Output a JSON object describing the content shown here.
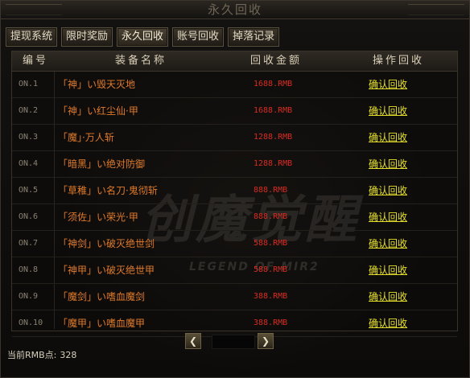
{
  "window": {
    "title": "永久回收"
  },
  "tabs": [
    {
      "label": "提现系统"
    },
    {
      "label": "限时奖励"
    },
    {
      "label": "永久回收"
    },
    {
      "label": "账号回收"
    },
    {
      "label": "掉落记录"
    }
  ],
  "table": {
    "headers": {
      "no": "编号",
      "name": "装备名称",
      "price": "回收金额",
      "action": "操作回收"
    },
    "rows": [
      {
        "no": "ON.1",
        "name": "「神」い毁天灭地",
        "price": "1688.RMB",
        "action": "确认回收"
      },
      {
        "no": "ON.2",
        "name": "「神」い红尘仙·甲",
        "price": "1688.RMB",
        "action": "确认回收"
      },
      {
        "no": "ON.3",
        "name": "「魔」·万人斩",
        "price": "1288.RMB",
        "action": "确认回收"
      },
      {
        "no": "ON.4",
        "name": "「暗黑」い绝对防御",
        "price": "1288.RMB",
        "action": "确认回收"
      },
      {
        "no": "ON.5",
        "name": "「草稚」い名刀·鬼彻斩",
        "price": "888.RMB",
        "action": "确认回收"
      },
      {
        "no": "ON.6",
        "name": "「须佐」い荣光·甲",
        "price": "888.RMB",
        "action": "确认回收"
      },
      {
        "no": "ON.7",
        "name": "「神剑」い破灭绝世剑",
        "price": "588.RMB",
        "action": "确认回收"
      },
      {
        "no": "ON.8",
        "name": "「神甲」い破灭绝世甲",
        "price": "588.RMB",
        "action": "确认回收"
      },
      {
        "no": "ON.9",
        "name": "「魔剑」い嗜血魔剑",
        "price": "388.RMB",
        "action": "确认回收"
      },
      {
        "no": "ON.10",
        "name": "「魔甲」い嗜血魔甲",
        "price": "388.RMB",
        "action": "确认回收"
      }
    ]
  },
  "watermark": {
    "logo": "创魔觉醒",
    "sub": "LEGEND OF MIR2"
  },
  "pager": {
    "prev_icon": "chevron-left-icon",
    "next_icon": "chevron-right-icon"
  },
  "status": {
    "label": "当前RMB点:",
    "value": "328"
  },
  "colors": {
    "item_name": "#e07a2a",
    "price": "#d62c22",
    "action_link": "#e6e02a"
  }
}
